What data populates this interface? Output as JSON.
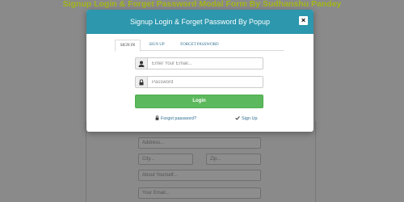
{
  "page": {
    "title": "Signup Login & Forget Password Modal Form By Sudhanshu Pandey"
  },
  "background_form": {
    "address_placeholder": "Address...",
    "city_placeholder": "City...",
    "zip_placeholder": "Zip...",
    "about_placeholder": "About Yourself...",
    "email_placeholder": "Your Email..."
  },
  "modal": {
    "title": "Signup Login & Forget Password By Popup",
    "close_label": "×",
    "tabs": [
      {
        "label": "SIGN IN",
        "active": true
      },
      {
        "label": "SIGN UP",
        "active": false
      },
      {
        "label": "FORGET PASSWORD",
        "active": false
      }
    ],
    "email_placeholder": "Enter Your Email...",
    "password_placeholder": "Password",
    "login_label": "Login",
    "forgot_label": "Forgot password?",
    "signup_label": "Sign Up",
    "colors": {
      "header": "#2c97ad",
      "button": "#5cb85c"
    }
  }
}
